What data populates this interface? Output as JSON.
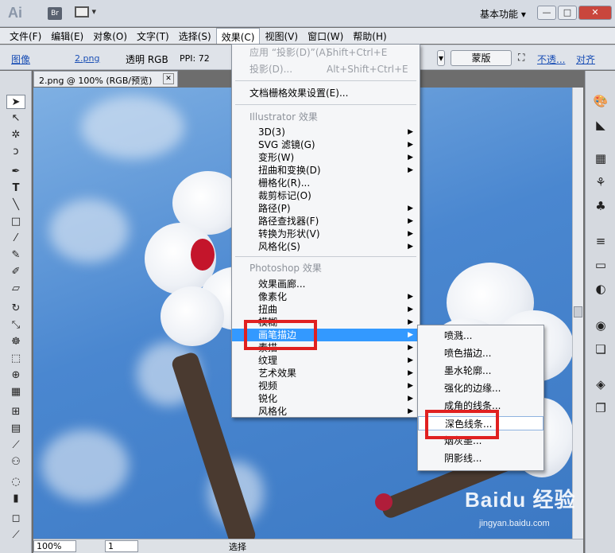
{
  "titlebar": {
    "logo": "Ai",
    "br": "Br",
    "workspace": "基本功能 ▾",
    "min": "—",
    "max": "□",
    "close": "✕"
  },
  "menubar": [
    "文件(F)",
    "编辑(E)",
    "对象(O)",
    "文字(T)",
    "选择(S)",
    "效果(C)",
    "视图(V)",
    "窗口(W)",
    "帮助(H)"
  ],
  "controlbar": {
    "image_label": "图像",
    "file": "2.png",
    "mode": "透明 RGB",
    "ppi": "PPI: 72",
    "mask_button": "蒙版",
    "opacity_link": "不透...",
    "align_link": "对齐"
  },
  "document_tab": {
    "title": "2.png @ 100% (RGB/预览)",
    "close": "✕"
  },
  "effects_menu": {
    "apply_last": "应用 “投影(D)”(A)",
    "apply_last_shortcut": "Shift+Ctrl+E",
    "last_effect": "投影(D)...",
    "last_effect_shortcut": "Alt+Shift+Ctrl+E",
    "raster_settings": "文档栅格效果设置(E)...",
    "illustrator_header": "Illustrator 效果",
    "illustrator_items": [
      "3D(3)",
      "SVG 滤镜(G)",
      "变形(W)",
      "扭曲和变换(D)",
      "栅格化(R)...",
      "裁剪标记(O)",
      "路径(P)",
      "路径查找器(F)",
      "转换为形状(V)",
      "风格化(S)"
    ],
    "photoshop_header": "Photoshop 效果",
    "photoshop_items": [
      "效果画廊...",
      "像素化",
      "扭曲",
      "模糊",
      "画笔描边",
      "素描",
      "纹理",
      "艺术效果",
      "视频",
      "锐化",
      "风格化"
    ]
  },
  "brush_submenu": {
    "items": [
      "喷溅...",
      "喷色描边...",
      "墨水轮廓...",
      "强化的边缘...",
      "成角的线条...",
      "深色线条...",
      "烟灰墨...",
      "阴影线..."
    ]
  },
  "statusbar": {
    "zoom": "100%",
    "page": "1",
    "mode": "选择"
  },
  "watermark": {
    "text": "Baidu 经验",
    "url": "jingyan.baidu.com"
  },
  "colors": {
    "highlight": "#3399ff",
    "annotation_red": "#e02020"
  }
}
